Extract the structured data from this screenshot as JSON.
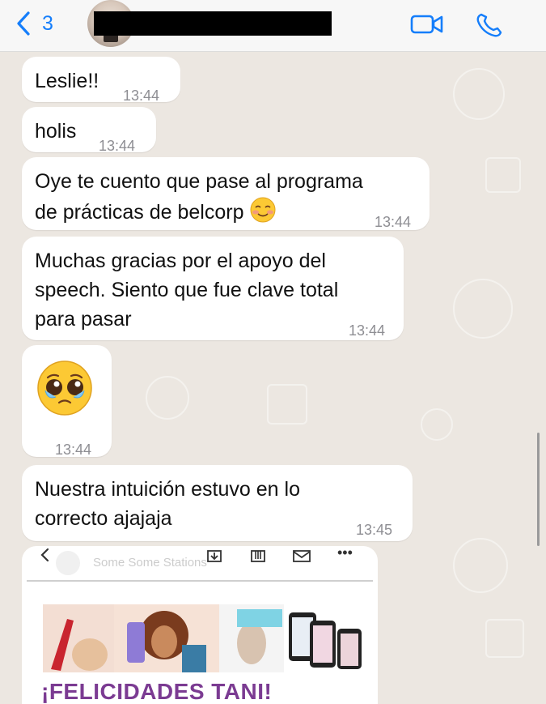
{
  "header": {
    "back_count": "3",
    "icons": {
      "back": "chevron-left-icon",
      "video": "video-camera-icon",
      "phone": "phone-icon"
    },
    "accent_color": "#157efb"
  },
  "messages": [
    {
      "text": "Leslie!!",
      "time": "13:44"
    },
    {
      "text": "holis",
      "time": "13:44"
    },
    {
      "text": "Oye te cuento que pase al programa\nde prácticas de belcorp",
      "emoji": "smiling-face-emoji",
      "time": "13:44"
    },
    {
      "text": "Muchas gracias por el apoyo del\nspeech. Siento que fue clave total\npara pasar",
      "time": "13:44"
    },
    {
      "emoji": "pleading-face-with-tears-emoji",
      "time": "13:44"
    },
    {
      "text": "Nuestra intuición estuvo en lo\ncorrecto ajajaja",
      "time": "13:45"
    }
  ],
  "image_message": {
    "toolbar_icons": [
      "back-icon",
      "download-icon",
      "archive-icon",
      "mail-icon",
      "more-icon"
    ],
    "more_label": "•••",
    "faded_header": "Some Some Stations",
    "caption": "¡FELICIDADES TANI!"
  }
}
